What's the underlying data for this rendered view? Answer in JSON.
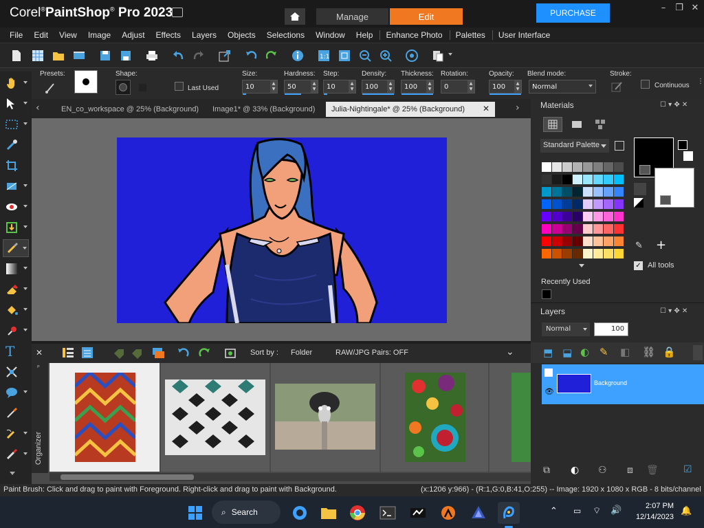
{
  "app": {
    "brand_corel": "Corel",
    "brand_reg": "®",
    "brand_name": "PaintShop",
    "brand_reg2": "®",
    "brand_pro": " Pro 2023",
    "tab_manage": "Manage",
    "tab_edit": "Edit",
    "purchase": "PURCHASE"
  },
  "menu": [
    "File",
    "Edit",
    "View",
    "Image",
    "Adjust",
    "Effects",
    "Layers",
    "Objects",
    "Selections",
    "Window",
    "Help",
    "Enhance Photo",
    "Palettes",
    "User Interface"
  ],
  "options": {
    "presets_label": "Presets:",
    "shape_label": "Shape:",
    "last_used": "Last Used",
    "size_label": "Size:",
    "size_value": "10",
    "hardness_label": "Hardness:",
    "hardness_value": "50",
    "step_label": "Step:",
    "step_value": "10",
    "density_label": "Density:",
    "density_value": "100",
    "thickness_label": "Thickness:",
    "thickness_value": "100",
    "rotation_label": "Rotation:",
    "rotation_value": "0",
    "opacity_label": "Opacity:",
    "opacity_value": "100",
    "blend_label": "Blend mode:",
    "blend_value": "Normal",
    "stroke_label": "Stroke:",
    "continuous": "Continuous"
  },
  "doc_tabs": [
    {
      "label": "EN_co_workspace @  25% (Background)"
    },
    {
      "label": "Image1* @  33% (Background)"
    },
    {
      "label": "Julia-Nightingale* @  25% (Background)"
    }
  ],
  "organizer": {
    "sort_label": "Sort by :",
    "sort_value": "Folder",
    "raw_pairs": "RAW/JPG Pairs: OFF",
    "side_label": "Organizer"
  },
  "materials": {
    "title": "Materials",
    "palette": "Standard Palette",
    "all_tools": "All tools",
    "recently_used": "Recently Used"
  },
  "layers": {
    "title": "Layers",
    "blend": "Normal",
    "opacity": "100",
    "layer_name": "Background"
  },
  "status": {
    "hint": "Paint Brush: Click and drag to paint with Foreground. Right-click and drag to paint with Background.",
    "info": "(x:1206 y:966) - (R:1,G:0,B:41,O:255) -- Image:  1920 x 1080 x RGB - 8 bits/channel"
  },
  "taskbar": {
    "search": "Search",
    "time": "2:07 PM",
    "date": "12/14/2023"
  },
  "colors": {
    "accent_orange": "#f07820",
    "purchase_blue": "#1e90ff",
    "layer_selected": "#3ea0ff",
    "canvas_bg": "#2020d8"
  }
}
